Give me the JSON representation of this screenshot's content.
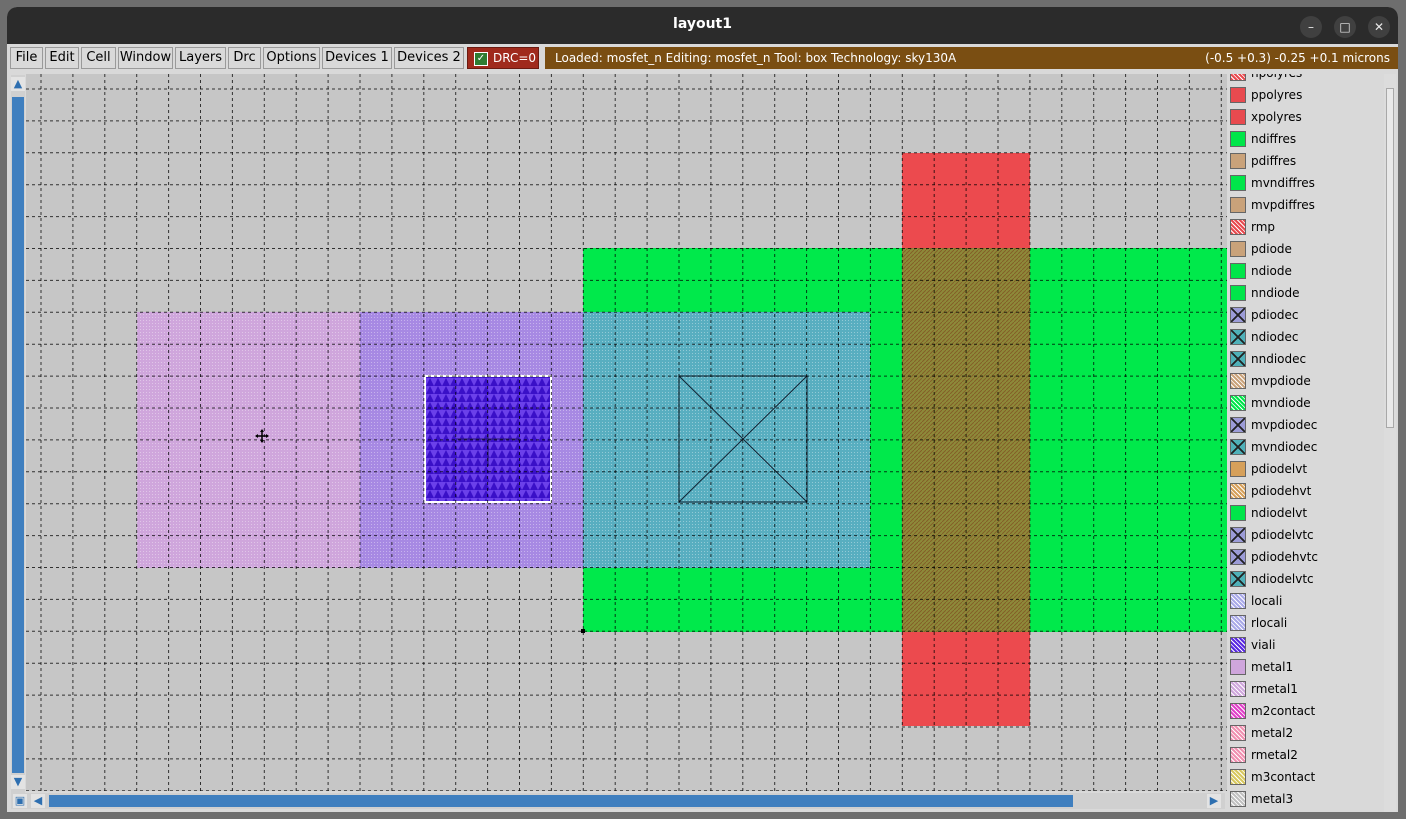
{
  "window": {
    "title": "layout1"
  },
  "window_controls": {
    "minimize": "–",
    "maximize": "□",
    "close": "✕"
  },
  "menu": [
    {
      "label": "File"
    },
    {
      "label": "Edit"
    },
    {
      "label": "Cell"
    },
    {
      "label": "Window"
    },
    {
      "label": "Layers"
    },
    {
      "label": "Drc"
    },
    {
      "label": "Options"
    },
    {
      "label": "Devices 1"
    },
    {
      "label": "Devices 2"
    }
  ],
  "drc": {
    "label": "DRC=0",
    "checked": true
  },
  "status": {
    "text": "Loaded: mosfet_n Editing: mosfet_n Tool: box  Technology: sky130A",
    "coords": "(-0.5 +0.3) -0.25 +0.1 microns"
  },
  "layers": [
    {
      "name": "npolyres",
      "color": "#e84a4f",
      "hatch": true
    },
    {
      "name": "ppolyres",
      "color": "#e84a4f",
      "hatch": false
    },
    {
      "name": "xpolyres",
      "color": "#e84a4f",
      "hatch": false
    },
    {
      "name": "ndiffres",
      "color": "#00e64a",
      "hatch": false
    },
    {
      "name": "pdiffres",
      "color": "#c9a27a",
      "hatch": false
    },
    {
      "name": "mvndiffres",
      "color": "#00e64a",
      "hatch": false
    },
    {
      "name": "mvpdiffres",
      "color": "#c9a27a",
      "hatch": false
    },
    {
      "name": "rmp",
      "color": "#e84a4f",
      "hatch": true
    },
    {
      "name": "pdiode",
      "color": "#c9a27a",
      "hatch": false
    },
    {
      "name": "ndiode",
      "color": "#00e64a",
      "hatch": false
    },
    {
      "name": "nndiode",
      "color": "#00e64a",
      "hatch": false
    },
    {
      "name": "pdiodec",
      "color": "#9b9bd6",
      "cross": true
    },
    {
      "name": "ndiodec",
      "color": "#4fb0b8",
      "cross": true
    },
    {
      "name": "nndiodec",
      "color": "#4fb0b8",
      "cross": true
    },
    {
      "name": "mvpdiode",
      "color": "#c9a27a",
      "hatch": true
    },
    {
      "name": "mvndiode",
      "color": "#00e64a",
      "hatch": true
    },
    {
      "name": "mvpdiodec",
      "color": "#9b9bd6",
      "cross": true
    },
    {
      "name": "mvndiodec",
      "color": "#4fb0b8",
      "cross": true
    },
    {
      "name": "pdiodelvt",
      "color": "#d6a05a",
      "hatch": false
    },
    {
      "name": "pdiodehvt",
      "color": "#d6a05a",
      "hatch": true
    },
    {
      "name": "ndiodelvt",
      "color": "#00e64a",
      "hatch": false
    },
    {
      "name": "pdiodelvtc",
      "color": "#9b9bd6",
      "cross": true
    },
    {
      "name": "pdiodehvtc",
      "color": "#9b9bd6",
      "cross": true
    },
    {
      "name": "ndiodelvtc",
      "color": "#4fb0b8",
      "cross": true
    },
    {
      "name": "locali",
      "color": "#a9a9e8",
      "hatch": true
    },
    {
      "name": "rlocali",
      "color": "#a9a9e8",
      "hatch": true
    },
    {
      "name": "viali",
      "color": "#5a2ae0",
      "hatch": true
    },
    {
      "name": "metal1",
      "color": "#cfa6dc",
      "hatch": false
    },
    {
      "name": "rmetal1",
      "color": "#cfa6dc",
      "hatch": true
    },
    {
      "name": "m2contact",
      "color": "#e040c8",
      "hatch": true
    },
    {
      "name": "metal2",
      "color": "#f090b0",
      "hatch": true
    },
    {
      "name": "rmetal2",
      "color": "#f090b0",
      "hatch": true
    },
    {
      "name": "m3contact",
      "color": "#d8c860",
      "hatch": true
    },
    {
      "name": "metal3",
      "color": "#c0c0c0",
      "hatch": true
    }
  ]
}
